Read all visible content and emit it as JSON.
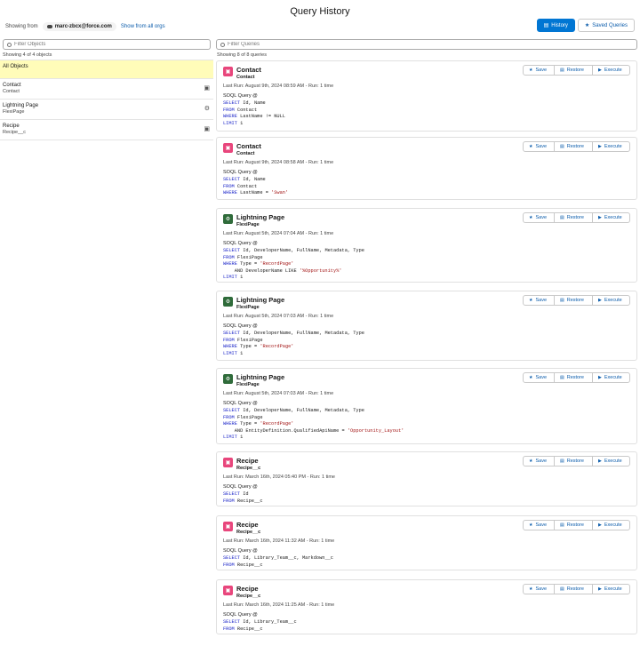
{
  "title": "Query History",
  "org": {
    "showing_label": "Showing from",
    "org_name": "marc-zbcx@force.com",
    "all_orgs_link": "Show from all orgs"
  },
  "top_buttons": {
    "history": "History",
    "saved": "Saved Queries"
  },
  "left": {
    "filter_placeholder": "Filter Objects",
    "count_text": "Showing 4 of 4 objects",
    "all_label": "All Objects",
    "objects": [
      {
        "name": "Contact",
        "sub": "Contact",
        "icon": "clipboard-icon"
      },
      {
        "name": "Lightning Page",
        "sub": "FlexiPage",
        "icon": "gear-icon"
      },
      {
        "name": "Recipe",
        "sub": "Recipe__c",
        "icon": "clipboard-icon"
      }
    ]
  },
  "right": {
    "filter_placeholder": "Filter Queries",
    "count_text": "Showing 8 of 8 queries",
    "action_labels": {
      "save": "Save",
      "restore": "Restore",
      "execute": "Execute"
    },
    "query_kind": "SOQL Query",
    "colors": {
      "contact": "#e8467c",
      "flexipage": "#2f6b3a",
      "recipe": "#e8467c"
    },
    "cards": [
      {
        "title": "Contact",
        "sub": "Contact",
        "color_key": "contact",
        "meta": "Last Run: August 9th, 2024 08:59 AM - Run: 1 time",
        "lines": [
          [
            [
              "kw",
              "SELECT"
            ],
            [
              "",
              "Id, Name"
            ]
          ],
          [
            [
              "kw",
              "FROM"
            ],
            [
              "",
              "Contact"
            ]
          ],
          [
            [
              "kw",
              "WHERE"
            ],
            [
              "",
              "LastName != NULL"
            ]
          ],
          [
            [
              "kw",
              "LIMIT"
            ],
            [
              "",
              "1"
            ]
          ]
        ]
      },
      {
        "title": "Contact",
        "sub": "Contact",
        "color_key": "contact",
        "meta": "Last Run: August 9th, 2024 08:58 AM - Run: 1 time",
        "lines": [
          [
            [
              "kw",
              "SELECT"
            ],
            [
              "",
              "Id, Name"
            ]
          ],
          [
            [
              "kw",
              "FROM"
            ],
            [
              "",
              "Contact"
            ]
          ],
          [
            [
              "kw",
              "WHERE"
            ],
            [
              "",
              "LastName = "
            ],
            [
              "str",
              "'Swan'"
            ]
          ]
        ]
      },
      {
        "title": "Lightning Page",
        "sub": "FlexiPage",
        "color_key": "flexipage",
        "meta": "Last Run: August 5th, 2024 07:04 AM - Run: 1 time",
        "lines": [
          [
            [
              "kw",
              "SELECT"
            ],
            [
              "",
              "Id, DeveloperName, FullName, Metadata, Type"
            ]
          ],
          [
            [
              "kw",
              "FROM"
            ],
            [
              "",
              "FlexiPage"
            ]
          ],
          [
            [
              "kw",
              "WHERE"
            ],
            [
              "",
              "Type = "
            ],
            [
              "str",
              "'RecordPage'"
            ]
          ],
          [
            [
              "",
              "    AND DeveloperName LIKE "
            ],
            [
              "str",
              "'%Opportunity%'"
            ]
          ],
          [
            [
              "kw",
              "LIMIT"
            ],
            [
              "",
              "1"
            ]
          ]
        ]
      },
      {
        "title": "Lightning Page",
        "sub": "FlexiPage",
        "color_key": "flexipage",
        "meta": "Last Run: August 5th, 2024 07:03 AM - Run: 1 time",
        "lines": [
          [
            [
              "kw",
              "SELECT"
            ],
            [
              "",
              "Id, DeveloperName, FullName, Metadata, Type"
            ]
          ],
          [
            [
              "kw",
              "FROM"
            ],
            [
              "",
              "FlexiPage"
            ]
          ],
          [
            [
              "kw",
              "WHERE"
            ],
            [
              "",
              "Type = "
            ],
            [
              "str",
              "'RecordPage'"
            ]
          ],
          [
            [
              "kw",
              "LIMIT"
            ],
            [
              "",
              "1"
            ]
          ]
        ]
      },
      {
        "title": "Lightning Page",
        "sub": "FlexiPage",
        "color_key": "flexipage",
        "meta": "Last Run: August 5th, 2024 07:03 AM - Run: 1 time",
        "lines": [
          [
            [
              "kw",
              "SELECT"
            ],
            [
              "",
              "Id, DeveloperName, FullName, Metadata, Type"
            ]
          ],
          [
            [
              "kw",
              "FROM"
            ],
            [
              "",
              "FlexiPage"
            ]
          ],
          [
            [
              "kw",
              "WHERE"
            ],
            [
              "",
              "Type = "
            ],
            [
              "str",
              "'RecordPage'"
            ]
          ],
          [
            [
              "",
              "    AND EntityDefinition.QualifiedApiName = "
            ],
            [
              "str",
              "'Opportunity_Layout'"
            ]
          ],
          [
            [
              "kw",
              "LIMIT"
            ],
            [
              "",
              "1"
            ]
          ]
        ]
      },
      {
        "title": "Recipe",
        "sub": "Recipe__c",
        "color_key": "recipe",
        "meta": "Last Run: March 16th, 2024 05:40 PM - Run: 1 time",
        "lines": [
          [
            [
              "kw",
              "SELECT"
            ],
            [
              "",
              "Id"
            ]
          ],
          [
            [
              "kw",
              "FROM"
            ],
            [
              "",
              "Recipe__c"
            ]
          ]
        ]
      },
      {
        "title": "Recipe",
        "sub": "Recipe__c",
        "color_key": "recipe",
        "meta": "Last Run: March 16th, 2024 11:32 AM - Run: 1 time",
        "lines": [
          [
            [
              "kw",
              "SELECT"
            ],
            [
              "",
              "Id, Library_Team__c, Markdown__c"
            ]
          ],
          [
            [
              "kw",
              "FROM"
            ],
            [
              "",
              "Recipe__c"
            ]
          ]
        ]
      },
      {
        "title": "Recipe",
        "sub": "Recipe__c",
        "color_key": "recipe",
        "meta": "Last Run: March 16th, 2024 11:25 AM - Run: 1 time",
        "lines": [
          [
            [
              "kw",
              "SELECT"
            ],
            [
              "",
              "Id, Library_Team__c"
            ]
          ],
          [
            [
              "kw",
              "FROM"
            ],
            [
              "",
              "Recipe__c"
            ]
          ]
        ]
      }
    ]
  }
}
